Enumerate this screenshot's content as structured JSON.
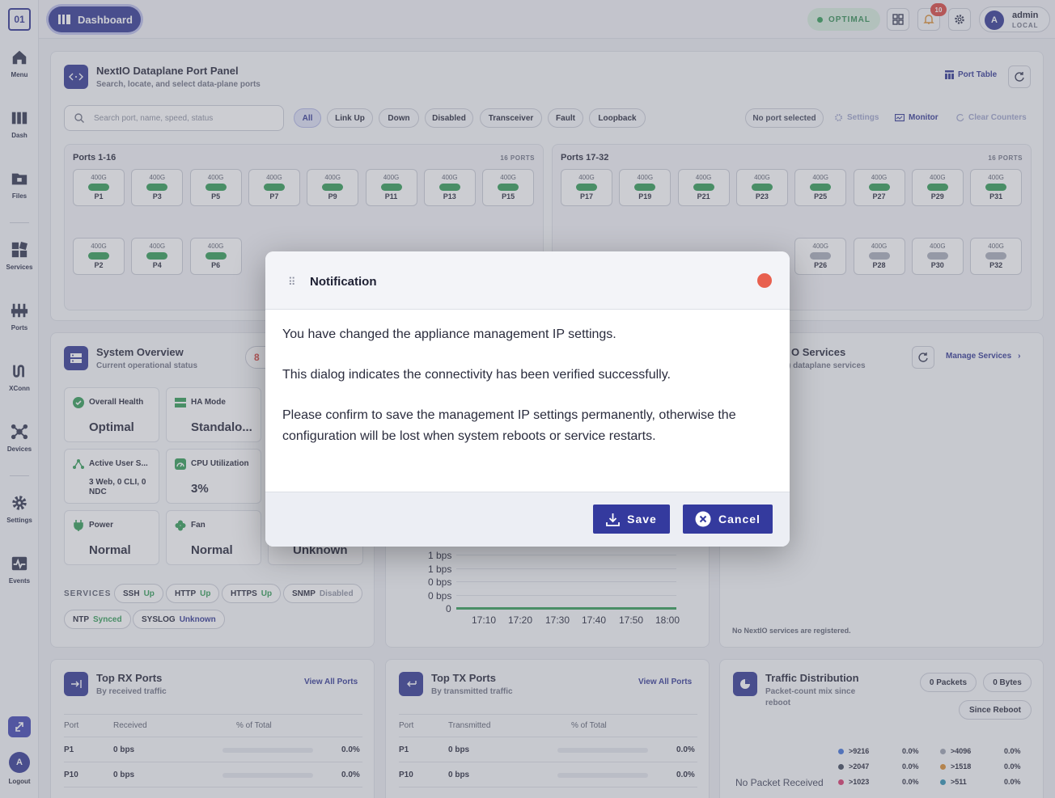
{
  "sidebar": {
    "logo": "01",
    "items": [
      {
        "label": "Menu",
        "icon": "home-icon"
      },
      {
        "label": "Dash",
        "icon": "dashboard-icon"
      },
      {
        "label": "Files",
        "icon": "folder-icon"
      },
      {
        "label": "Services",
        "icon": "services-icon"
      },
      {
        "label": "Ports",
        "icon": "ports-icon"
      },
      {
        "label": "XConn",
        "icon": "xconn-icon"
      },
      {
        "label": "Devices",
        "icon": "devices-icon"
      },
      {
        "label": "Settings",
        "icon": "gear-icon"
      },
      {
        "label": "Events",
        "icon": "events-icon"
      }
    ],
    "logout_label": "Logout",
    "avatar_letter": "A"
  },
  "topbar": {
    "dashboard_label": "Dashboard",
    "status": "OPTIMAL",
    "notification_count": "10",
    "user_name": "admin",
    "user_realm": "LOCAL",
    "user_initial": "A"
  },
  "port_panel": {
    "title": "NextIO Dataplane Port Panel",
    "subtitle": "Search, locate, and select data-plane ports",
    "port_table_label": "Port Table",
    "search_placeholder": "Search port, name, speed, status",
    "filters": [
      "All",
      "Link Up",
      "Down",
      "Disabled",
      "Transceiver",
      "Fault",
      "Loopback"
    ],
    "no_port_selected": "No port selected",
    "settings_label": "Settings",
    "monitor_label": "Monitor",
    "clear_counters_label": "Clear Counters",
    "groups": [
      {
        "title": "Ports 1-16",
        "count": "16 PORTS"
      },
      {
        "title": "Ports 17-32",
        "count": "16 PORTS"
      }
    ],
    "speed": "400G",
    "row1_left": [
      "P1",
      "P3",
      "P5",
      "P7",
      "P9",
      "P11",
      "P13",
      "P15"
    ],
    "row1_right": [
      "P17",
      "P19",
      "P21",
      "P23",
      "P25",
      "P27",
      "P29",
      "P31"
    ],
    "row2_left": [
      "P2",
      "P4",
      "P6"
    ],
    "row2_right": [
      "P26",
      "P28",
      "P30",
      "P32"
    ]
  },
  "system_overview": {
    "title": "System Overview",
    "subtitle": "Current operational status",
    "badge": "8",
    "tiles": [
      {
        "label": "Overall Health",
        "value": "Optimal"
      },
      {
        "label": "HA Mode",
        "value": "Standalo..."
      },
      {
        "label": "Active User S...",
        "value": "3 Web, 0 CLI, 0 NDC"
      },
      {
        "label": "CPU Utilization",
        "value": "3%"
      },
      {
        "label": "Power",
        "value": "Normal"
      },
      {
        "label": "Fan",
        "value": "Normal"
      },
      {
        "label": "",
        "value": "Unknown"
      }
    ],
    "services_label": "SERVICES",
    "services": [
      {
        "name": "SSH",
        "status": "Up"
      },
      {
        "name": "HTTP",
        "status": "Up"
      },
      {
        "name": "HTTPS",
        "status": "Up"
      },
      {
        "name": "SNMP",
        "status": "Disabled"
      },
      {
        "name": "NTP",
        "status": "Synced"
      },
      {
        "name": "SYSLOG",
        "status": "Unknown"
      }
    ]
  },
  "traffic_chart": {
    "y_ticks": [
      "1 bps",
      "1 bps",
      "0 bps",
      "0 bps",
      "0"
    ],
    "x_ticks": [
      "17:10",
      "17:20",
      "17:30",
      "17:40",
      "17:50",
      "18:00"
    ]
  },
  "nextio_services": {
    "title_fragment": "O Services",
    "subtitle_fragment": ") dataplane services",
    "manage_label": "Manage Services",
    "empty": "No NextIO services are registered."
  },
  "top_rx": {
    "title": "Top RX Ports",
    "subtitle": "By received traffic",
    "link": "View All Ports",
    "headers": [
      "Port",
      "Received",
      "% of Total"
    ],
    "rows": [
      {
        "port": "P1",
        "value": "0 bps",
        "pct": "0.0%"
      },
      {
        "port": "P10",
        "value": "0 bps",
        "pct": "0.0%"
      }
    ]
  },
  "top_tx": {
    "title": "Top TX Ports",
    "subtitle": "By transmitted traffic",
    "link": "View All Ports",
    "headers": [
      "Port",
      "Transmitted",
      "% of Total"
    ],
    "rows": [
      {
        "port": "P1",
        "value": "0 bps",
        "pct": "0.0%"
      },
      {
        "port": "P10",
        "value": "0 bps",
        "pct": "0.0%"
      }
    ]
  },
  "traffic_dist": {
    "title": "Traffic Distribution",
    "subtitle_line1": "Packet-count mix since",
    "subtitle_line2": "reboot",
    "packets_label": "0 Packets",
    "bytes_label": "0 Bytes",
    "since_label": "Since Reboot",
    "empty": "No Packet Received",
    "legend": [
      {
        "label": ">9216",
        "pct": "0.0%",
        "color": "#3c6fd8"
      },
      {
        "label": ">4096",
        "pct": "0.0%",
        "color": "#9aa0ae"
      },
      {
        "label": ">2047",
        "pct": "0.0%",
        "color": "#3a4458"
      },
      {
        "label": ">1518",
        "pct": "0.0%",
        "color": "#d98a2a"
      },
      {
        "label": ">1023",
        "pct": "0.0%",
        "color": "#d8336a"
      },
      {
        "label": ">511",
        "pct": "0.0%",
        "color": "#2a8fb0"
      }
    ]
  },
  "modal": {
    "title": "Notification",
    "line1": "You have changed the appliance management IP settings.",
    "line2": "This dialog indicates the connectivity has been verified successfully.",
    "line3": "Please confirm to save the management IP settings permanently, otherwise the configuration will be lost when system reboots or service restarts.",
    "save_label": "Save",
    "cancel_label": "Cancel"
  },
  "colors": {
    "brand": "#2d3290",
    "link_up": "#2d9a52",
    "close_dot": "#e8604f"
  }
}
